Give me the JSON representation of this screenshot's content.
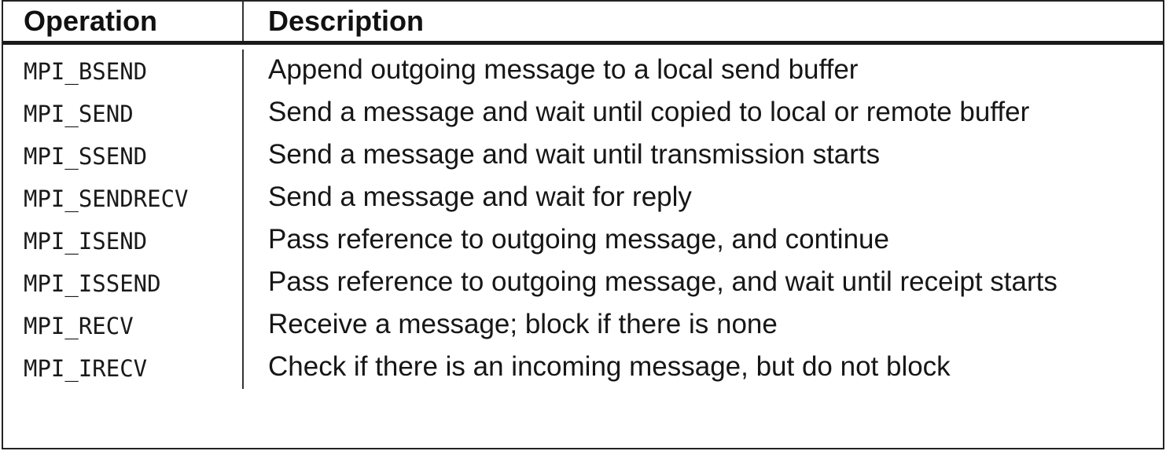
{
  "table": {
    "headers": {
      "operation": "Operation",
      "description": "Description"
    },
    "rows": [
      {
        "operation": "MPI_BSEND",
        "description": "Append outgoing message to a local send buffer"
      },
      {
        "operation": "MPI_SEND",
        "description": "Send a message and wait until copied to local or remote buffer"
      },
      {
        "operation": "MPI_SSEND",
        "description": "Send a message and wait until transmission starts"
      },
      {
        "operation": "MPI_SENDRECV",
        "description": "Send a message and wait for reply"
      },
      {
        "operation": "MPI_ISEND",
        "description": "Pass reference to outgoing message, and continue"
      },
      {
        "operation": "MPI_ISSEND",
        "description": "Pass reference to outgoing message, and wait until receipt starts"
      },
      {
        "operation": "MPI_RECV",
        "description": "Receive a message; block if there is none"
      },
      {
        "operation": "MPI_IRECV",
        "description": "Check if there is an incoming message, but do not block"
      }
    ]
  }
}
